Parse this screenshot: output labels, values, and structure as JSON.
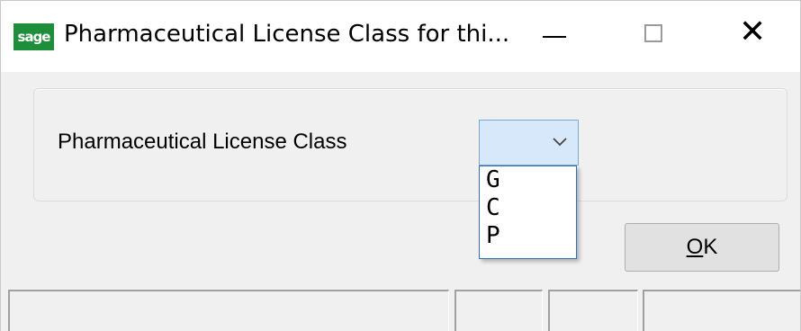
{
  "window": {
    "app_icon_text": "sage",
    "title": "Pharmaceutical License Class for thi...",
    "minimize_icon": "minimize-icon",
    "maximize_icon": "maximize-icon",
    "close_glyph": "✕"
  },
  "form": {
    "label": "Pharmaceutical License Class",
    "combo_value": "",
    "options": [
      "G",
      "C",
      "P"
    ]
  },
  "buttons": {
    "ok_mnemonic": "O",
    "ok_rest": "K"
  },
  "status_bar": {
    "panes": [
      "",
      "",
      "",
      ""
    ]
  },
  "colors": {
    "app_icon_bg": "#1f8e3a",
    "combo_bg": "#d6e8fa",
    "combo_border": "#7aa7d6",
    "list_border": "#2f6fb4"
  }
}
